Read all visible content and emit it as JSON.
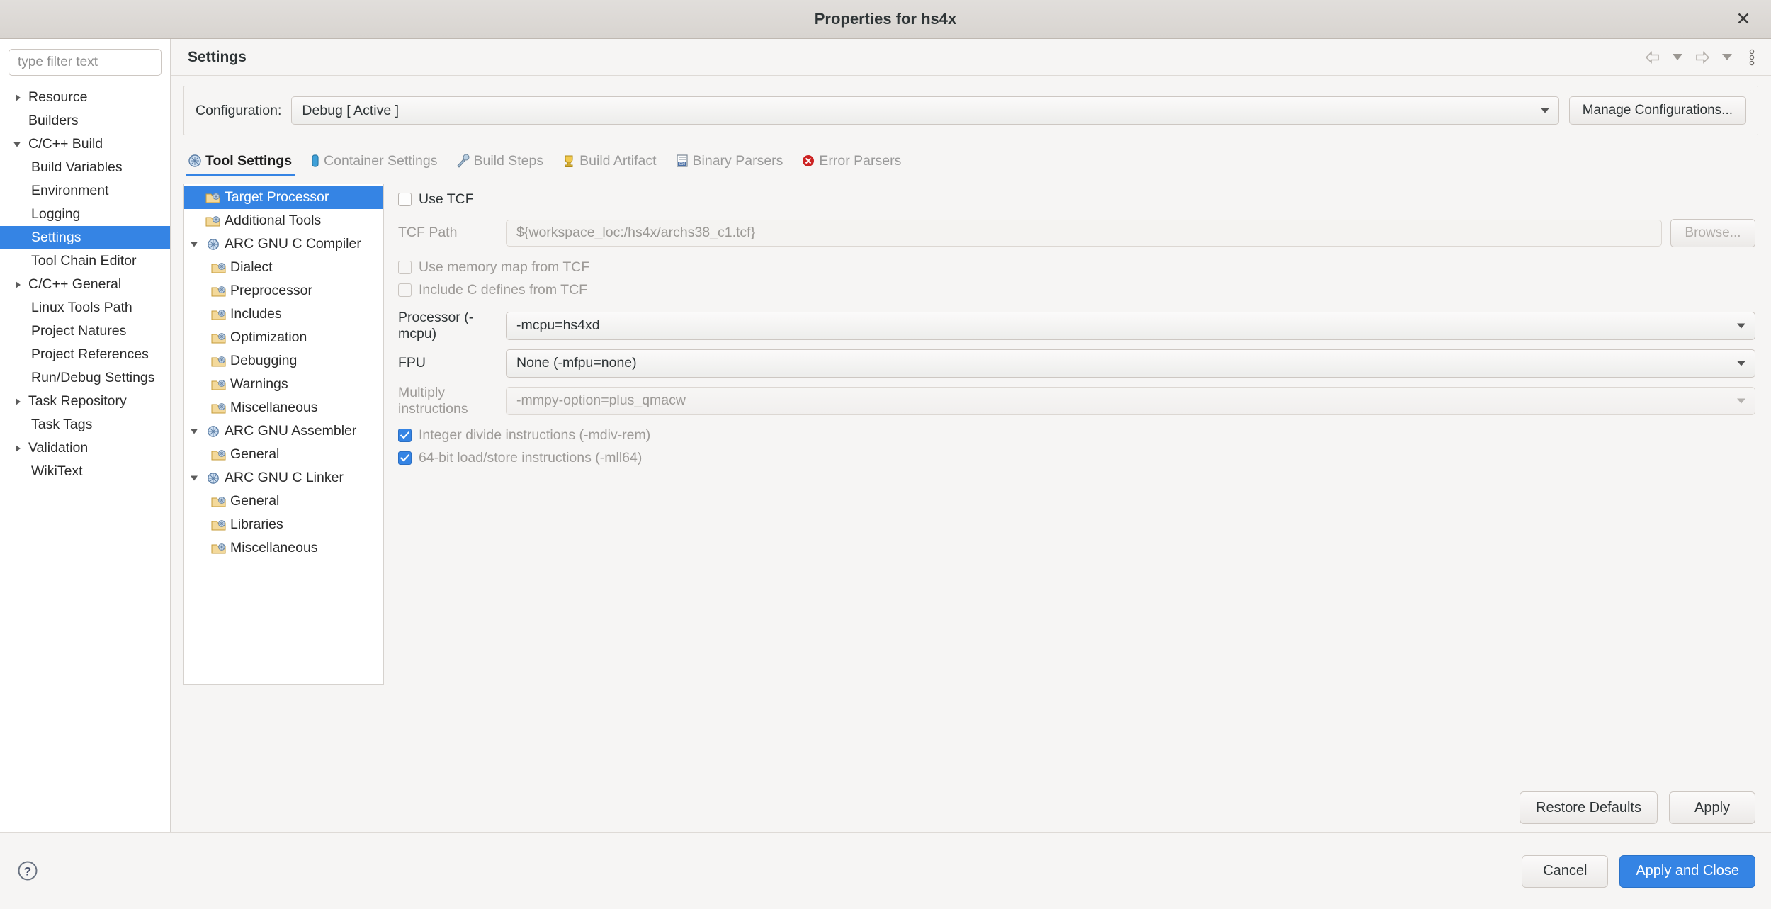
{
  "window": {
    "title": "Properties for hs4x",
    "close_label": "✕"
  },
  "sidebar": {
    "filter_placeholder": "type filter text",
    "filter_value": "",
    "items": [
      {
        "label": "Resource",
        "level": 0,
        "twisty": "right",
        "selected": false
      },
      {
        "label": "Builders",
        "level": 0,
        "twisty": "none",
        "selected": false
      },
      {
        "label": "C/C++ Build",
        "level": 0,
        "twisty": "down",
        "selected": false
      },
      {
        "label": "Build Variables",
        "level": 1,
        "twisty": "none",
        "selected": false
      },
      {
        "label": "Environment",
        "level": 1,
        "twisty": "none",
        "selected": false
      },
      {
        "label": "Logging",
        "level": 1,
        "twisty": "none",
        "selected": false
      },
      {
        "label": "Settings",
        "level": 1,
        "twisty": "none",
        "selected": true
      },
      {
        "label": "Tool Chain Editor",
        "level": 1,
        "twisty": "none",
        "selected": false
      },
      {
        "label": "C/C++ General",
        "level": 0,
        "twisty": "right",
        "selected": false
      },
      {
        "label": "Linux Tools Path",
        "level": 1,
        "twisty": "none",
        "selected": false
      },
      {
        "label": "Project Natures",
        "level": 1,
        "twisty": "none",
        "selected": false
      },
      {
        "label": "Project References",
        "level": 1,
        "twisty": "none",
        "selected": false
      },
      {
        "label": "Run/Debug Settings",
        "level": 1,
        "twisty": "none",
        "selected": false
      },
      {
        "label": "Task Repository",
        "level": 0,
        "twisty": "right",
        "selected": false
      },
      {
        "label": "Task Tags",
        "level": 1,
        "twisty": "none",
        "selected": false
      },
      {
        "label": "Validation",
        "level": 0,
        "twisty": "right",
        "selected": false
      },
      {
        "label": "WikiText",
        "level": 1,
        "twisty": "none",
        "selected": false
      }
    ]
  },
  "page": {
    "title": "Settings",
    "toolbar": [
      {
        "name": "back-arrow-icon",
        "glyph": "⇦"
      },
      {
        "name": "back-dropdown-icon",
        "glyph": "▾"
      },
      {
        "name": "forward-arrow-icon",
        "glyph": "⇨"
      },
      {
        "name": "forward-dropdown-icon",
        "glyph": "▾"
      },
      {
        "name": "view-menu-icon",
        "glyph": "⋮"
      }
    ]
  },
  "configuration": {
    "label": "Configuration:",
    "value": "Debug  [ Active ]",
    "manage_button": "Manage Configurations..."
  },
  "tabs": [
    {
      "label": "Tool Settings",
      "icon": "tool-settings-icon",
      "active": true
    },
    {
      "label": "Container Settings",
      "icon": "container-icon",
      "active": false
    },
    {
      "label": "Build Steps",
      "icon": "build-steps-icon",
      "active": false
    },
    {
      "label": "Build Artifact",
      "icon": "build-artifact-icon",
      "active": false
    },
    {
      "label": "Binary Parsers",
      "icon": "binary-parsers-icon",
      "active": false
    },
    {
      "label": "Error Parsers",
      "icon": "error-parsers-icon",
      "active": false
    }
  ],
  "tool_tree": [
    {
      "label": "Target Processor",
      "level": 0,
      "twisty": "none",
      "icon": "folder-tool-icon",
      "selected": true
    },
    {
      "label": "Additional Tools",
      "level": 0,
      "twisty": "none",
      "icon": "folder-tool-icon",
      "selected": false
    },
    {
      "label": "ARC GNU C Compiler",
      "level": 0,
      "twisty": "down",
      "icon": "compiler-icon",
      "selected": false
    },
    {
      "label": "Dialect",
      "level": 1,
      "twisty": "none",
      "icon": "folder-tool-icon",
      "selected": false
    },
    {
      "label": "Preprocessor",
      "level": 1,
      "twisty": "none",
      "icon": "folder-tool-icon",
      "selected": false
    },
    {
      "label": "Includes",
      "level": 1,
      "twisty": "none",
      "icon": "folder-tool-icon",
      "selected": false
    },
    {
      "label": "Optimization",
      "level": 1,
      "twisty": "none",
      "icon": "folder-tool-icon",
      "selected": false
    },
    {
      "label": "Debugging",
      "level": 1,
      "twisty": "none",
      "icon": "folder-tool-icon",
      "selected": false
    },
    {
      "label": "Warnings",
      "level": 1,
      "twisty": "none",
      "icon": "folder-tool-icon",
      "selected": false
    },
    {
      "label": "Miscellaneous",
      "level": 1,
      "twisty": "none",
      "icon": "folder-tool-icon",
      "selected": false
    },
    {
      "label": "ARC GNU Assembler",
      "level": 0,
      "twisty": "down",
      "icon": "compiler-icon",
      "selected": false
    },
    {
      "label": "General",
      "level": 1,
      "twisty": "none",
      "icon": "folder-tool-icon",
      "selected": false
    },
    {
      "label": "ARC GNU C Linker",
      "level": 0,
      "twisty": "down",
      "icon": "compiler-icon",
      "selected": false
    },
    {
      "label": "General",
      "level": 1,
      "twisty": "none",
      "icon": "folder-tool-icon",
      "selected": false
    },
    {
      "label": "Libraries",
      "level": 1,
      "twisty": "none",
      "icon": "folder-tool-icon",
      "selected": false
    },
    {
      "label": "Miscellaneous",
      "level": 1,
      "twisty": "none",
      "icon": "folder-tool-icon",
      "selected": false
    }
  ],
  "form": {
    "use_tcf": {
      "label": "Use TCF",
      "checked": false,
      "disabled": false
    },
    "tcf_path": {
      "label": "TCF Path",
      "value": "${workspace_loc:/hs4x/archs38_c1.tcf}",
      "disabled": true,
      "browse_label": "Browse..."
    },
    "use_memory_map": {
      "label": "Use memory map from TCF",
      "checked": false,
      "disabled": true
    },
    "include_c_defines": {
      "label": "Include C defines from TCF",
      "checked": false,
      "disabled": true
    },
    "processor": {
      "label": "Processor (-mcpu)",
      "value": "-mcpu=hs4xd",
      "disabled": false
    },
    "fpu": {
      "label": "FPU",
      "value": "None (-mfpu=none)",
      "disabled": false
    },
    "multiply": {
      "label": "Multiply instructions",
      "value": "-mmpy-option=plus_qmacw",
      "disabled": true
    },
    "integer_divide": {
      "label": "Integer divide instructions (-mdiv-rem)",
      "checked": true,
      "disabled": true
    },
    "load_store_64": {
      "label": "64-bit load/store instructions (-mll64)",
      "checked": true,
      "disabled": true
    }
  },
  "footer": {
    "restore_defaults": "Restore Defaults",
    "apply": "Apply",
    "cancel": "Cancel",
    "apply_and_close": "Apply and Close",
    "help_icon": "help-icon"
  },
  "colors": {
    "accent": "#3584e4",
    "window_bg": "#f6f5f4",
    "panel_bg": "#ffffff",
    "text": "#2e3436",
    "disabled_text": "#9d9a97",
    "error": "#cc2222"
  }
}
